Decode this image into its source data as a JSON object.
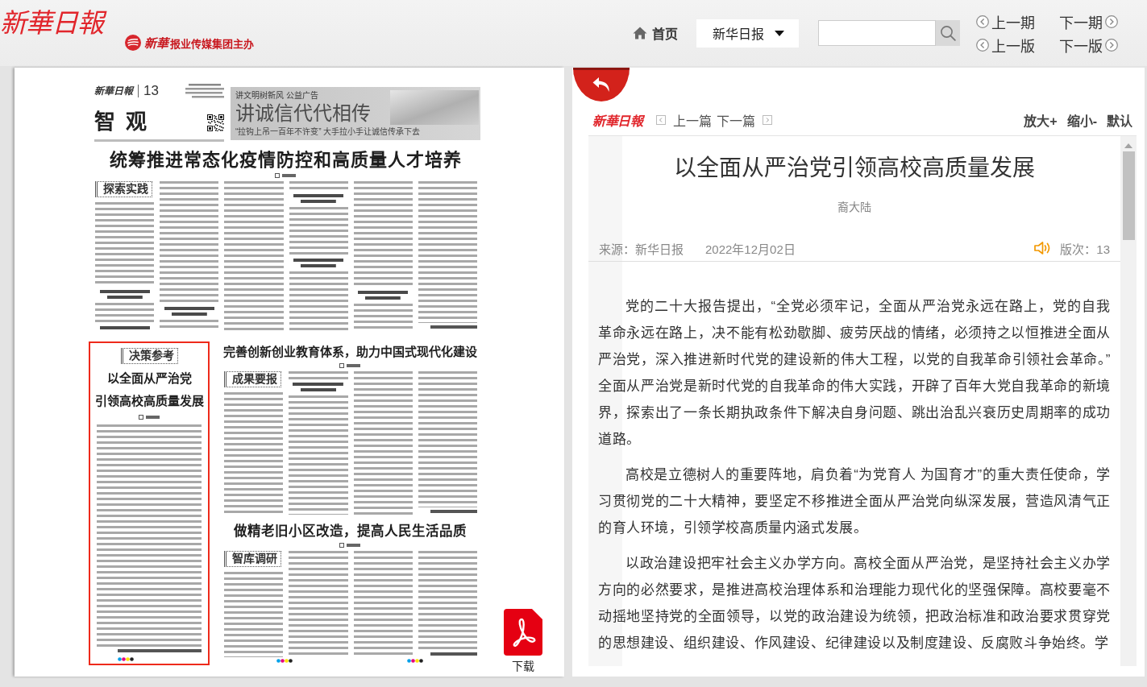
{
  "header": {
    "logo": "新華日報",
    "publisher_mark": "新華",
    "publisher": "报业传媒集团主办"
  },
  "nav": {
    "home": "首页",
    "paper_select": "新华日报"
  },
  "issue_nav": [
    {
      "label": "上一期",
      "kind": "prev"
    },
    {
      "label": "下一期",
      "kind": "next"
    },
    {
      "label": "上一版",
      "kind": "prev"
    },
    {
      "label": "下一版",
      "kind": "next"
    }
  ],
  "paper_page": {
    "masthead": "新華日報",
    "page_number": "13",
    "section": "智 观",
    "ad": {
      "tag": "讲文明树新风 公益广告",
      "title": "讲诚信代代相传",
      "caption": "“拉钩上吊一百年不许变” 大手拉小手让诚信传承下去"
    },
    "articles": [
      {
        "headline": [
          "统筹推进常态化疫情防控和高质量人才培养"
        ],
        "column_tag": "探索实践",
        "selected": false
      },
      {
        "headline": [
          "以全面从严治党",
          "引领高校高质量发展"
        ],
        "column_tag": "决策参考",
        "selected": true
      },
      {
        "headline": [
          "完善创新创业教育体系，助力中国式现代化建设"
        ],
        "column_tag": "成果要报",
        "selected": false
      },
      {
        "headline": [
          "做精老旧小区改造，提高人民生活品质"
        ],
        "column_tag": "智库调研",
        "selected": false
      }
    ]
  },
  "download": "下载",
  "article": {
    "logo": "新華日報",
    "pager": [
      {
        "label": "上一篇",
        "kind": "prev"
      },
      {
        "label": "下一篇",
        "kind": "next"
      }
    ],
    "text_size": [
      "放大+",
      "缩小-",
      "默认"
    ],
    "title": "以全面从严治党引领高校高质量发展",
    "author": "裔大陆",
    "source": "来源：新华日报",
    "date": "2022年12月02日",
    "page": "版次：13",
    "paragraphs": [
      "党的二十大报告提出，“全党必须牢记，全面从严治党永远在路上，党的自我革命永远在路上，决不能有松劲歇脚、疲劳厌战的情绪，必须持之以恒推进全面从严治党，深入推进新时代党的建设新的伟大工程，以党的自我革命引领社会革命。”全面从严治党是新时代党的自我革命的伟大实践，开辟了百年大党自我革命的新境界，探索出了一条长期执政条件下解决自身问题、跳出治乱兴衰历史周期率的成功道路。",
      "高校是立德树人的重要阵地，肩负着“为党育人 为国育才”的重大责任使命，学习贯彻党的二十大精神，要坚定不移推进全面从严治党向纵深发展，营造风清气正的育人环境，引领学校高质量内涵式发展。",
      "以政治建设把牢社会主义办学方向。高校全面从严治党，是坚持社会主义办学方向的必然要求，是推进高校治理体系和治理能力现代化的坚强保障。高校要毫不动摇地坚持党的全面领导，以党的政治建设为统领，把政治标准和政治要求贯穿党的思想建设、组织建设、作风建设、纪律建设以及制度建设、反腐败斗争始终。学"
    ]
  }
}
